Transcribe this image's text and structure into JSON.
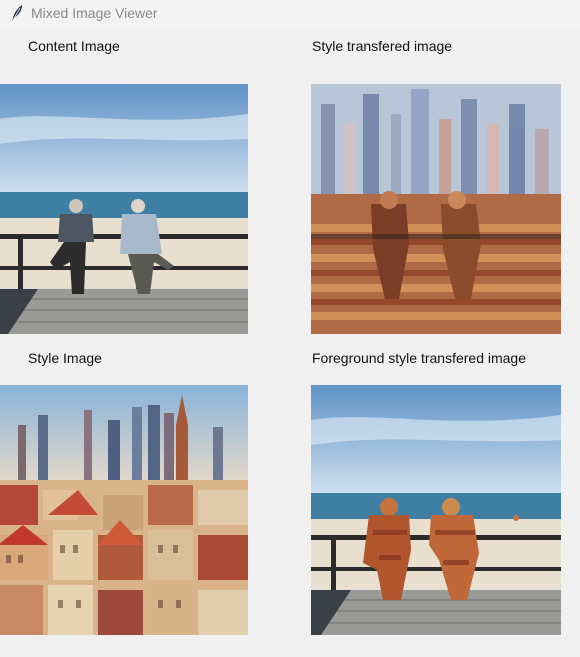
{
  "window": {
    "title": "Mixed Image Viewer",
    "icon": "feather-icon"
  },
  "panels": {
    "content": {
      "label": "Content Image"
    },
    "style_transfer": {
      "label": "Style transfered image"
    },
    "style": {
      "label": "Style Image"
    },
    "foreground_transfer": {
      "label": "Foreground style transfered image"
    }
  }
}
